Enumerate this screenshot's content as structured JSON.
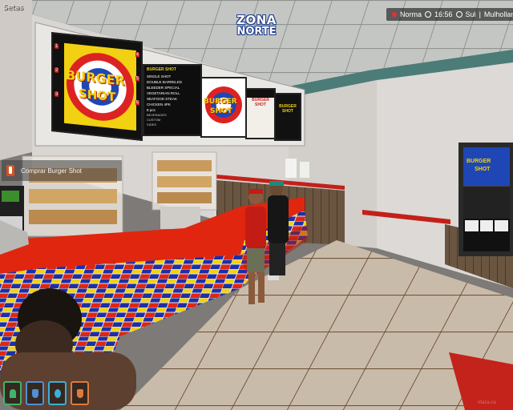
{
  "hud": {
    "top_left_label": "Setas",
    "brand": {
      "line1": "ZONA",
      "line2": "NORTE"
    },
    "status": {
      "player": "Norma",
      "time": "16:56",
      "zone": "Sul",
      "street": "Mulholland",
      "separator": "|"
    },
    "notification": {
      "text": "Comprar Burger Shot",
      "icon": "burger-bag-icon"
    },
    "stats": [
      {
        "name": "health",
        "icon": "heart-icon",
        "color": "#3fb56a"
      },
      {
        "name": "armor",
        "icon": "shield-icon",
        "color": "#4f8fd6"
      },
      {
        "name": "thirst",
        "icon": "water-drop-icon",
        "color": "#38b0d8"
      },
      {
        "name": "hunger",
        "icon": "food-icon",
        "color": "#e07a3a"
      }
    ],
    "watermark": "ntaza.ca"
  },
  "menu_boards": {
    "left": {
      "line1": "BURGER",
      "line2": "SHOT",
      "side_numbers": [
        "1",
        "2",
        "3",
        "4",
        "5",
        "6"
      ]
    },
    "center_menu": {
      "title": "BURGER SHOT",
      "items": [
        "SINGLE SHOT",
        "DOUBLE BARRELED",
        "BLEEDER SPECIAL",
        "VEGETARIAN ROLL",
        "SEAFOOD STEAK",
        "CHICKEN 4PK",
        "8 pcs"
      ],
      "footer": [
        "BEVERAGES",
        "CUSTOM",
        "SIDES"
      ]
    },
    "logo_board": {
      "line1": "BURGER",
      "line2": "SHOT"
    },
    "right_menu": {
      "line1": "BURGER",
      "line2": "SHOT"
    },
    "far_right": {
      "line1": "BURGER",
      "line2": "SHOT"
    }
  },
  "colors": {
    "counter_red": "#e0260f",
    "tile_blue": "#1d2fa8",
    "tile_yellow": "#f2d112",
    "floor_tile": "#c7b9a8",
    "wall": "#d8d4d2",
    "ceiling": "#c0c2bf",
    "trim_teal": "#4b7c78"
  }
}
